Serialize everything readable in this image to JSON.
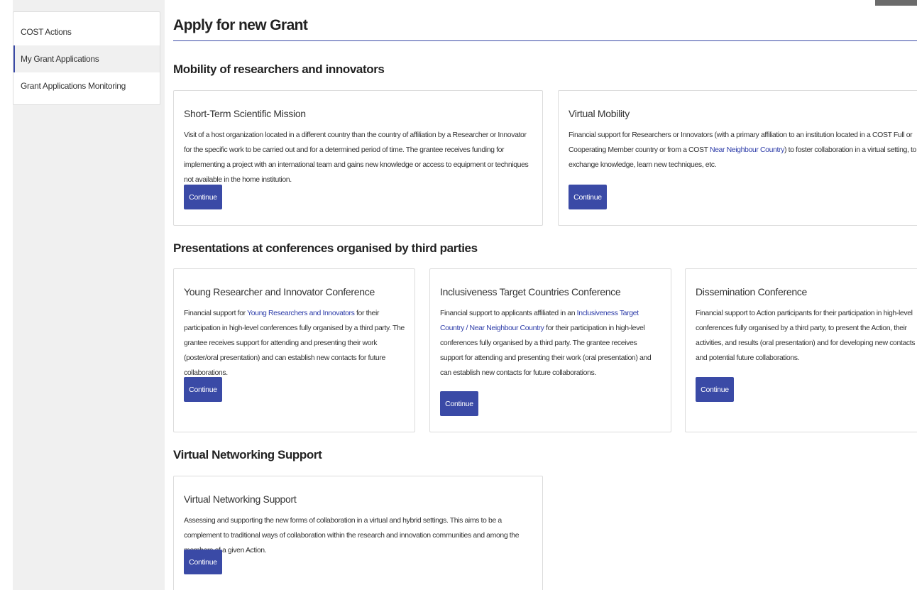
{
  "sidebar": {
    "items": [
      {
        "label": "COST Actions"
      },
      {
        "label": "My Grant Applications"
      },
      {
        "label": "Grant Applications Monitoring"
      }
    ]
  },
  "main": {
    "title": "Apply for new Grant",
    "sections": [
      {
        "title": "Mobility of researchers and innovators",
        "cards": [
          {
            "title": "Short-Term Scientific Mission",
            "desc": "Visit of a host organization located in a different country than the country of affiliation by a Researcher or Innovator for the specific work to be carried out and for a determined period of time. The grantee receives funding for implementing a project with an international team and gains new knowledge or access to equipment or techniques not available in the home institution.",
            "button": "Continue"
          },
          {
            "title": "Virtual Mobility",
            "desc_a": "Financial support for Researchers or Innovators (with a primary affiliation to an institution located in a COST Full or Cooperating Member country or from a COST ",
            "link": "Near Neighbour Country",
            "desc_b": ") to foster collaboration in a virtual setting, to exchange knowledge, learn new techniques, etc.",
            "button": "Continue"
          }
        ]
      },
      {
        "title": "Presentations at conferences organised by third parties",
        "cards": [
          {
            "title": "Young Researcher and Innovator Conference",
            "desc_a": "Financial support for ",
            "link": "Young Researchers and Innovators",
            "desc_b": " for their participation in high-level conferences fully organised by a third party. The grantee receives support for attending and presenting their work (poster/oral presentation) and can establish new contacts for future collaborations.",
            "button": "Continue"
          },
          {
            "title": "Inclusiveness Target Countries Conference",
            "desc_a": "Financial support to applicants affiliated in an ",
            "link": "Inclusiveness Target Country / Near Neighbour Country",
            "desc_b": " for their participation in high-level conferences fully organised by a third party. The grantee receives support for attending and presenting their work (oral presentation) and can establish new contacts for future collaborations.",
            "button": "Continue"
          },
          {
            "title": "Dissemination Conference",
            "desc": "Financial support to Action participants for their participation in high-level conferences fully organised by a third party, to present the Action, their activities, and results (oral presentation) and for developing new contacts and potential future collaborations.",
            "button": "Continue"
          }
        ]
      },
      {
        "title": "Virtual Networking Support",
        "cards": [
          {
            "title": "Virtual Networking Support",
            "desc": "Assessing and supporting the new forms of collaboration in a virtual and hybrid settings. This aims to be a complement to traditional ways of collaboration within the research and innovation communities and among the members of a given Action.",
            "button": "Continue"
          }
        ]
      }
    ]
  }
}
